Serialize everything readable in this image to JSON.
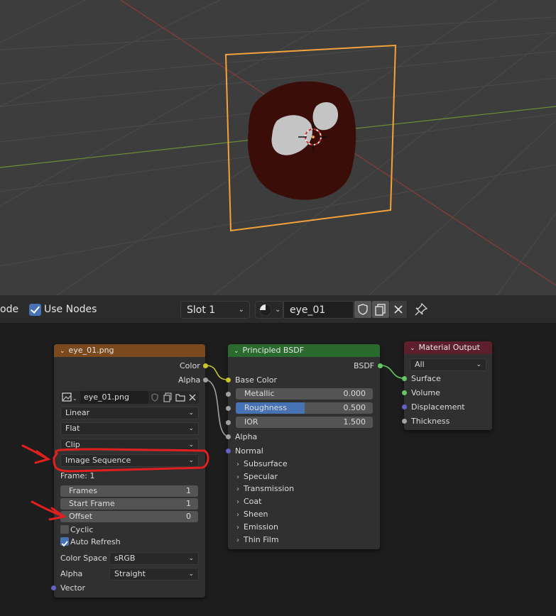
{
  "header": {
    "mode_fragment": "ode",
    "use_nodes_label": "Use Nodes",
    "slot_label": "Slot 1",
    "material_name": "eye_01"
  },
  "image_node": {
    "title": "eye_01.png",
    "out_color": "Color",
    "out_alpha": "Alpha",
    "image_name": "eye_01.png",
    "interpolation": "Linear",
    "projection": "Flat",
    "extension": "Clip",
    "source": "Image Sequence",
    "frame_info": "Frame: 1",
    "frames_label": "Frames",
    "frames_value": "1",
    "start_frame_label": "Start Frame",
    "start_frame_value": "1",
    "offset_label": "Offset",
    "offset_value": "0",
    "cyclic_label": "Cyclic",
    "auto_refresh_label": "Auto Refresh",
    "color_space_label": "Color Space",
    "color_space_value": "sRGB",
    "alpha_label": "Alpha",
    "alpha_value": "Straight",
    "in_vector": "Vector"
  },
  "bsdf_node": {
    "title": "Principled BSDF",
    "out_bsdf": "BSDF",
    "base_color": "Base Color",
    "metallic_label": "Metallic",
    "metallic_value": "0.000",
    "roughness_label": "Roughness",
    "roughness_value": "0.500",
    "roughness_fraction": 0.5,
    "ior_label": "IOR",
    "ior_value": "1.500",
    "alpha": "Alpha",
    "normal": "Normal",
    "panels": [
      "Subsurface",
      "Specular",
      "Transmission",
      "Coat",
      "Sheen",
      "Emission",
      "Thin Film"
    ]
  },
  "output_node": {
    "title": "Material Output",
    "target": "All",
    "inputs": [
      "Surface",
      "Volume",
      "Displacement",
      "Thickness"
    ]
  },
  "colors": {
    "image_header": "#7a4a1e",
    "bsdf_header": "#2a6a2e",
    "output_header": "#5e1f2c",
    "socket_yellow": "#c7c729",
    "socket_gray": "#a1a1a1",
    "socket_green": "#63c763",
    "socket_purple": "#6363c7",
    "selection_orange": "#f5a23a",
    "annotation_red": "#e0201e",
    "accent_blue": "#4772b3"
  },
  "icons": [
    "image-icon",
    "fake-user-shield-icon",
    "duplicate-icon",
    "folder-icon",
    "close-icon",
    "material-sphere-icon",
    "pin-icon"
  ]
}
